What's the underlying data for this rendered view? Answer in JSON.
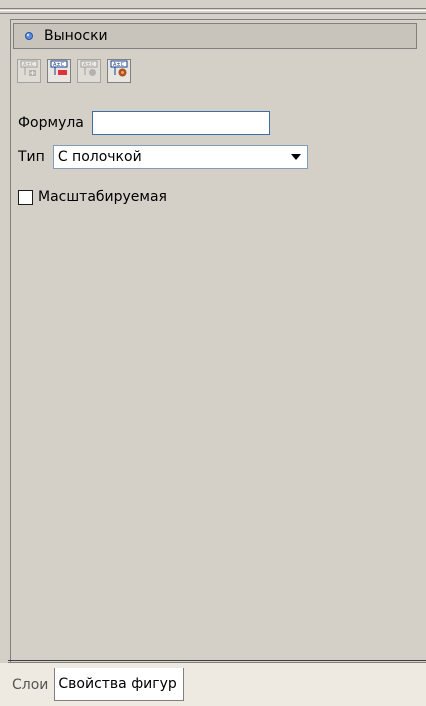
{
  "section": {
    "title": "Выноски",
    "bullet_icon": "blue-dot-icon"
  },
  "toolbar": {
    "buttons": [
      {
        "icon": "add-callout-icon",
        "enabled": false
      },
      {
        "icon": "remove-callout-icon",
        "enabled": true
      },
      {
        "icon": "edit-callout-icon",
        "enabled": false
      },
      {
        "icon": "callout-properties-icon",
        "enabled": true
      }
    ]
  },
  "form": {
    "formula_label": "Формула",
    "formula_value": "",
    "type_label": "Тип",
    "type_value": "С полочкой",
    "scalable_label": "Масштабируемая",
    "scalable_checked": false
  },
  "tabs": [
    {
      "label": "Слои",
      "active": false
    },
    {
      "label": "Свойства фигур",
      "active": true
    }
  ],
  "colors": {
    "background": "#d4d0c8",
    "accent": "#3a6ea5"
  }
}
